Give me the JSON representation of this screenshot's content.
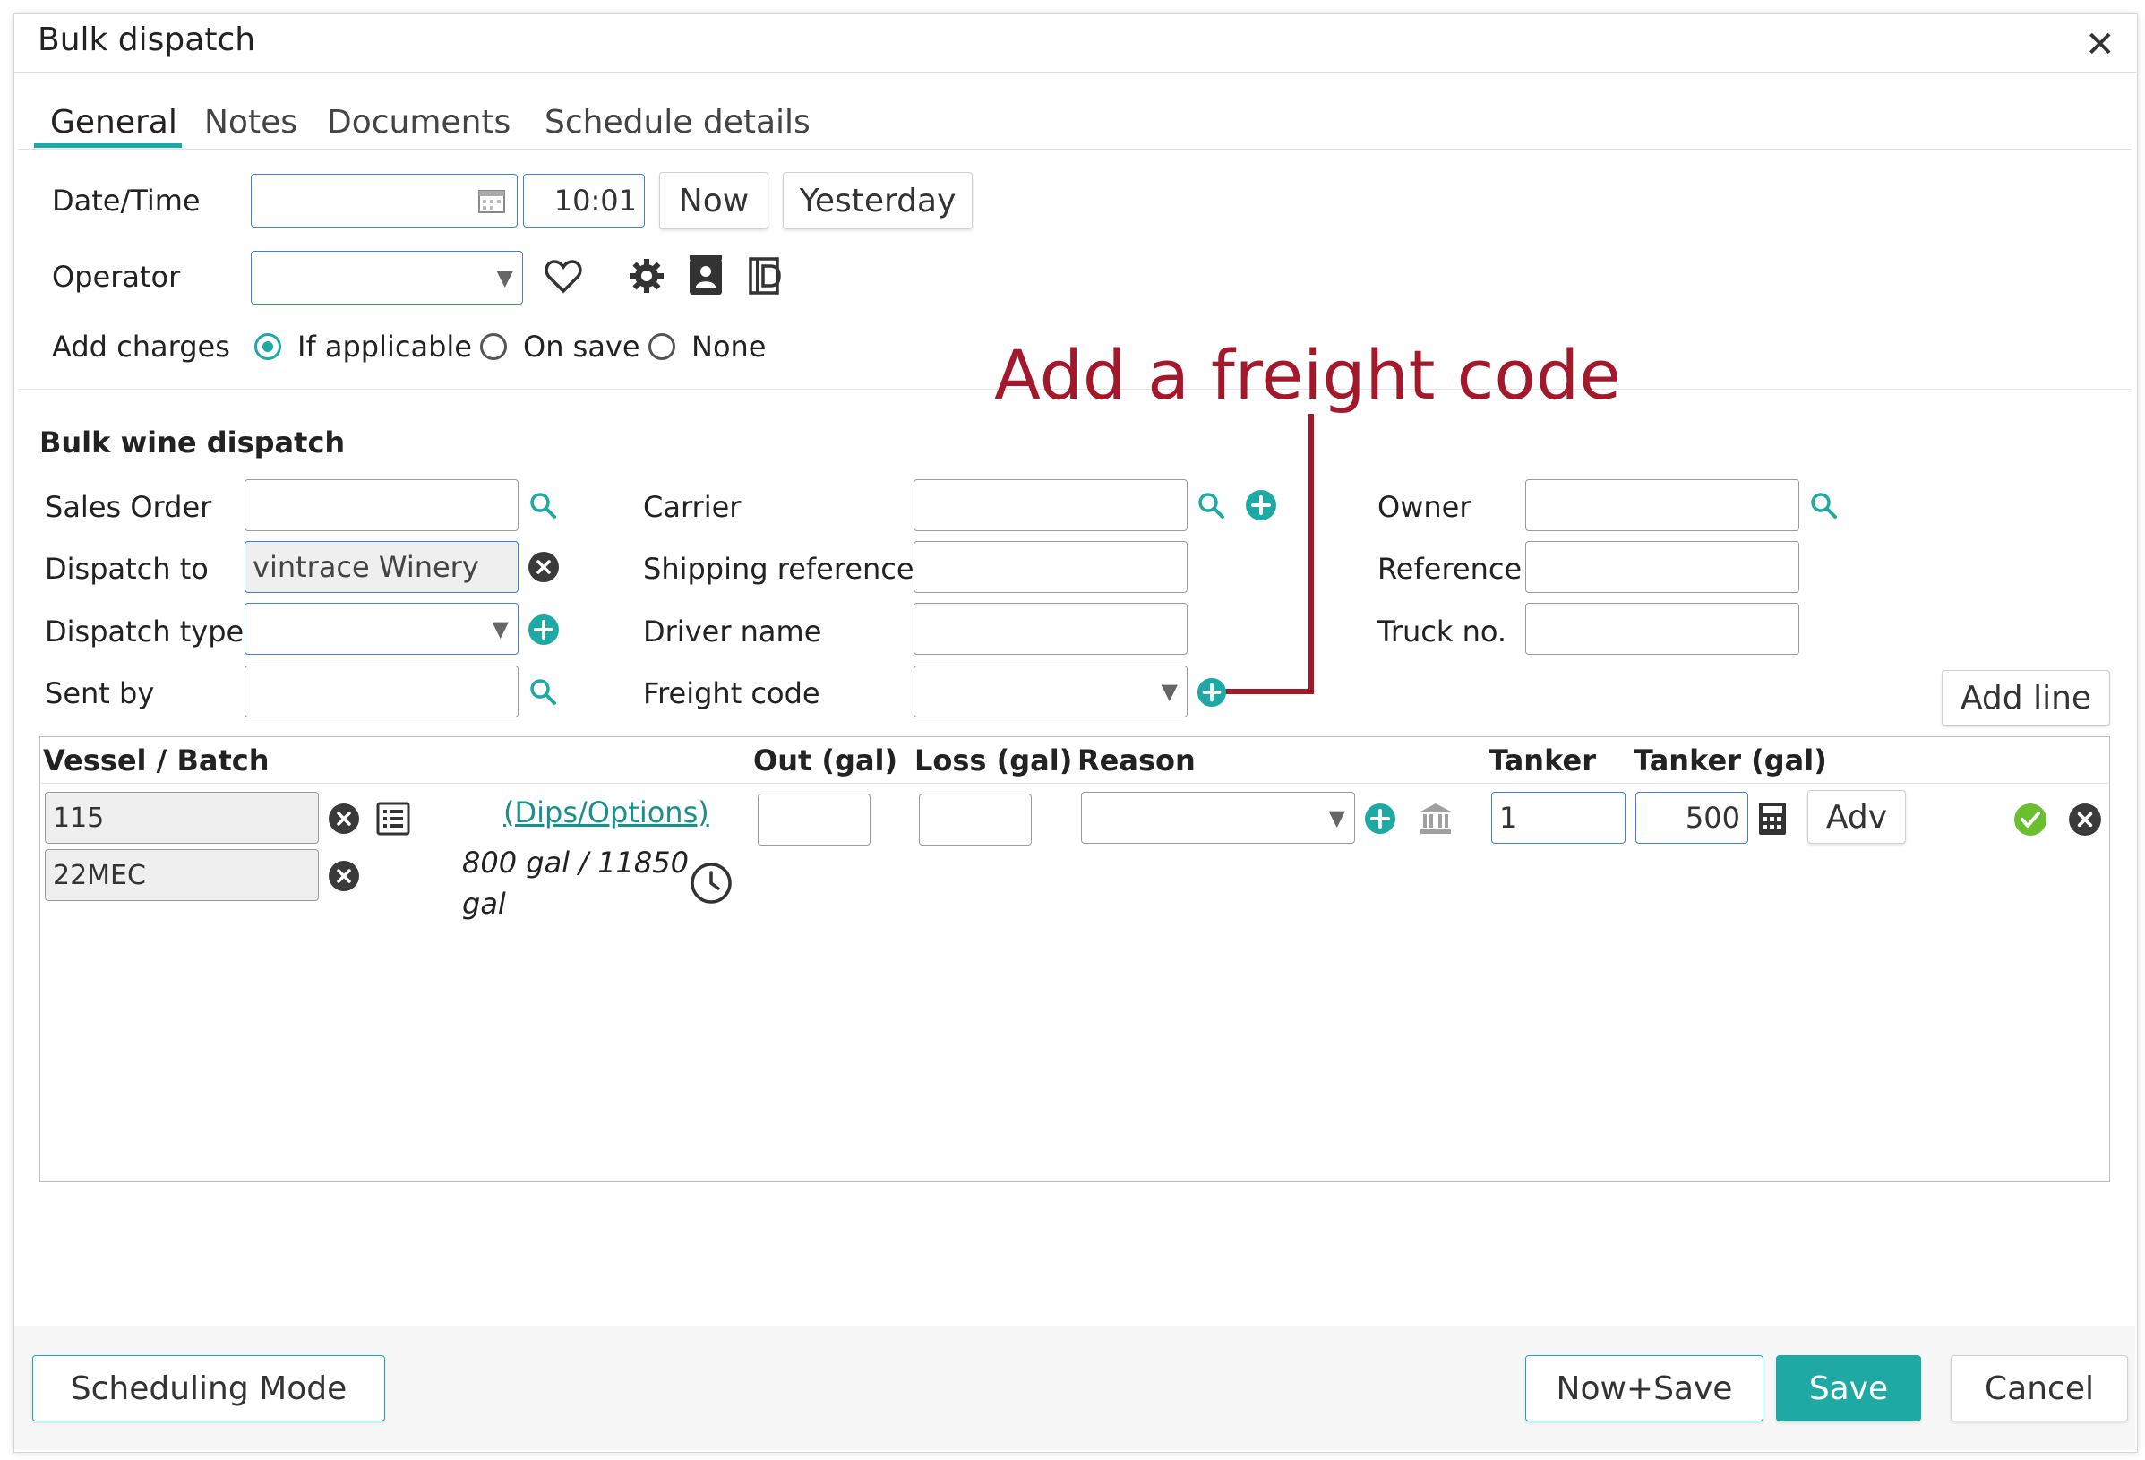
{
  "dialog": {
    "title": "Bulk dispatch",
    "tabs": [
      "General",
      "Notes",
      "Documents",
      "Schedule details"
    ],
    "active_tab": "General"
  },
  "general": {
    "datetime_label": "Date/Time",
    "date_value": "",
    "time_value": "10:01",
    "now_label": "Now",
    "yesterday_label": "Yesterday",
    "operator_label": "Operator",
    "operator_value": "",
    "charges_label": "Add charges",
    "charges_options": [
      "If applicable",
      "On save",
      "None"
    ],
    "charges_selected": "If applicable"
  },
  "annotation": {
    "text": "Add a freight code",
    "color": "#a3182a"
  },
  "bulk": {
    "heading": "Bulk wine dispatch",
    "sales_order_label": "Sales Order",
    "sales_order_value": "",
    "dispatch_to_label": "Dispatch to",
    "dispatch_to_value": "vintrace Winery",
    "dispatch_type_label": "Dispatch type",
    "dispatch_type_value": "",
    "sent_by_label": "Sent by",
    "sent_by_value": "",
    "carrier_label": "Carrier",
    "carrier_value": "",
    "shipping_ref_label": "Shipping reference",
    "shipping_ref_value": "",
    "driver_label": "Driver name",
    "driver_value": "",
    "freight_label": "Freight code",
    "freight_value": "",
    "owner_label": "Owner",
    "owner_value": "",
    "reference_label": "Reference",
    "reference_value": "",
    "truck_label": "Truck no.",
    "truck_value": "",
    "add_line_label": "Add line"
  },
  "grid": {
    "columns": [
      "Vessel / Batch",
      "Out (gal)",
      "Loss (gal)",
      "Reason",
      "Tanker",
      "Tanker (gal)"
    ],
    "row": {
      "vessel": "115",
      "batch": "22MEC",
      "dips_link": "(Dips/Options)",
      "capacity_line1": "800 gal / 11850",
      "capacity_line2": "gal",
      "out_gal": "",
      "loss_gal": "",
      "reason": "",
      "tanker": "1",
      "tanker_gal": "500",
      "adv_label": "Adv"
    }
  },
  "footer": {
    "scheduling_label": "Scheduling Mode",
    "now_save_label": "Now+Save",
    "save_label": "Save",
    "cancel_label": "Cancel"
  },
  "colors": {
    "accent": "#1ea9a4",
    "input_border_focus": "#3d83d0",
    "save_bg": "#1ea9a4"
  }
}
